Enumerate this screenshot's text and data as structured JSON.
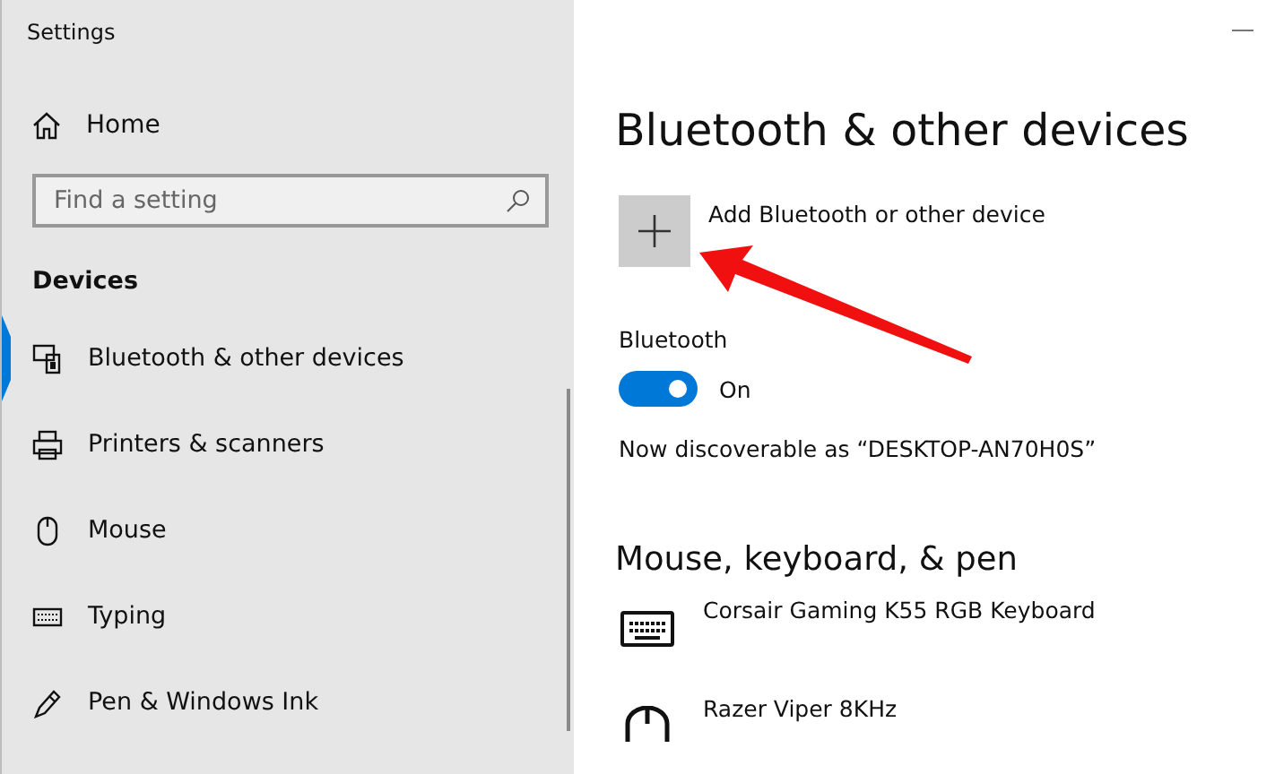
{
  "window": {
    "title": "Settings"
  },
  "sidebar": {
    "home": {
      "label": "Home"
    },
    "search": {
      "placeholder": "Find a setting"
    },
    "section": "Devices",
    "items": [
      {
        "label": "Bluetooth & other devices",
        "kind": "bluetooth",
        "selected": true
      },
      {
        "label": "Printers & scanners",
        "kind": "printer",
        "selected": false
      },
      {
        "label": "Mouse",
        "kind": "mouse",
        "selected": false
      },
      {
        "label": "Typing",
        "kind": "typing",
        "selected": false
      },
      {
        "label": "Pen & Windows Ink",
        "kind": "pen",
        "selected": false
      }
    ]
  },
  "main": {
    "title": "Bluetooth & other devices",
    "add_button": {
      "label": "Add Bluetooth or other device"
    },
    "bluetooth": {
      "label": "Bluetooth",
      "on": true,
      "state_text": "On"
    },
    "discoverable": "Now discoverable as “DESKTOP-AN70H0S”",
    "section": "Mouse, keyboard, & pen",
    "devices": [
      {
        "name": "Corsair Gaming K55 RGB Keyboard",
        "kind": "keyboard"
      },
      {
        "name": "Razer Viper 8KHz",
        "kind": "mouse"
      }
    ]
  }
}
